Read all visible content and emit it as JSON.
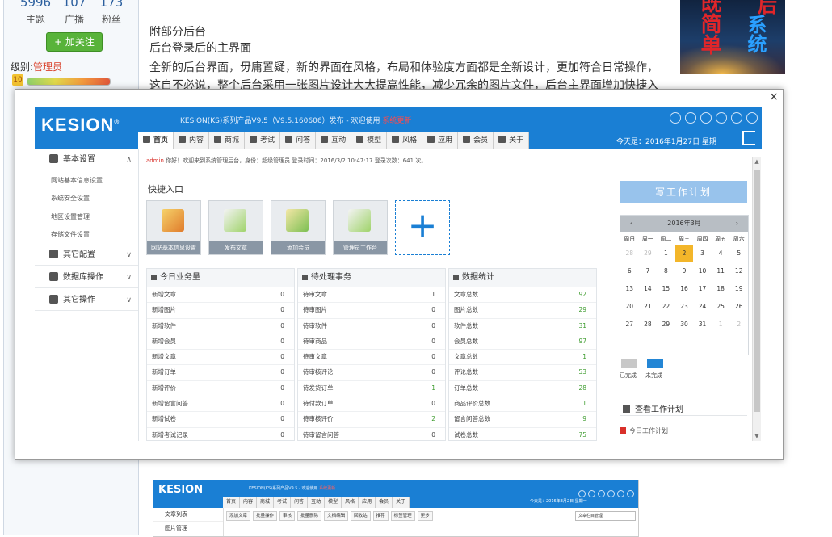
{
  "profile": {
    "stats": [
      {
        "num": "5996",
        "label": "主题"
      },
      {
        "num": "107",
        "label": "广播"
      },
      {
        "num": "173",
        "label": "粉丝"
      }
    ],
    "follow_label": "+ 加关注",
    "level_prefix": "级别:",
    "level_name": "管理员",
    "level_icon": "10"
  },
  "post": {
    "lines": [
      "附部分后台",
      "后台登录后的主界面",
      "全新的后台界面，毋庸置疑，新的界面在风格，布局和体验度方面都是全新设计，更加符合日常操作，",
      "这自不必说，整个后台采用一张图片设计大大提高性能，减少冗余的图片文件，后台主界面增加快捷入"
    ]
  },
  "banner": {
    "text_a": "既简单",
    "text_b": "系统",
    "text_c": "后"
  },
  "lightbox": {
    "close": "×"
  },
  "app": {
    "logo": "KESION",
    "logo_mark": "®",
    "sysinfo": "KESION(KS)系列产品V9.5（V9.5.160606）发布 - 欢迎使用",
    "sysinfo_red": "系统更新",
    "date": "今天是：2016年1月27日 星期一",
    "tabs": [
      "首页",
      "内容",
      "商城",
      "考试",
      "问答",
      "互动",
      "模型",
      "风格",
      "应用",
      "会员",
      "关于"
    ],
    "sidebar": {
      "groups": [
        {
          "label": "基本设置",
          "chev": "∧"
        },
        {
          "label": "其它配置",
          "chev": "∨"
        },
        {
          "label": "数据库操作",
          "chev": "∨"
        },
        {
          "label": "其它操作",
          "chev": "∨"
        }
      ],
      "subs": [
        "网站基本信息设置",
        "系统安全设置",
        "地区设置管理",
        "存储文件设置"
      ]
    },
    "breadcrumb_red": "admin",
    "breadcrumb": "你好！欢迎来到系统管理后台，身份：超级管理员 登录时间：2016/3/2 10:47:17 登录次数：641 次。",
    "quick_title": "快捷入口",
    "quick": [
      "网站基本信息设置",
      "发布文章",
      "添加会员",
      "管理员工作台"
    ],
    "panels": [
      {
        "title": "今日业务量",
        "rows": [
          {
            "k": "新增文章",
            "v": "0"
          },
          {
            "k": "新增图片",
            "v": "0"
          },
          {
            "k": "新增软件",
            "v": "0"
          },
          {
            "k": "新增会员",
            "v": "0"
          },
          {
            "k": "新增文章",
            "v": "0"
          },
          {
            "k": "新增订单",
            "v": "0"
          },
          {
            "k": "新增评价",
            "v": "0"
          },
          {
            "k": "新增留言问答",
            "v": "0"
          },
          {
            "k": "新增试卷",
            "v": "0"
          },
          {
            "k": "新增考试记录",
            "v": "0"
          }
        ]
      },
      {
        "title": "待处理事务",
        "rows": [
          {
            "k": "待审文章",
            "v": "1"
          },
          {
            "k": "待审图片",
            "v": "0"
          },
          {
            "k": "待审软件",
            "v": "0"
          },
          {
            "k": "待审商品",
            "v": "0"
          },
          {
            "k": "待审文章",
            "v": "0"
          },
          {
            "k": "待审核评论",
            "v": "0"
          },
          {
            "k": "待发货订单",
            "v": "1"
          },
          {
            "k": "待付款订单",
            "v": "0"
          },
          {
            "k": "待审核评价",
            "v": "2"
          },
          {
            "k": "待审留言问答",
            "v": "0"
          }
        ]
      },
      {
        "title": "数据统计",
        "rows": [
          {
            "k": "文章总数",
            "v": "92"
          },
          {
            "k": "图片总数",
            "v": "29"
          },
          {
            "k": "软件总数",
            "v": "31"
          },
          {
            "k": "会员总数",
            "v": "97"
          },
          {
            "k": "文章总数",
            "v": "1"
          },
          {
            "k": "评论总数",
            "v": "53"
          },
          {
            "k": "订单总数",
            "v": "28"
          },
          {
            "k": "商品评价总数",
            "v": "1"
          },
          {
            "k": "留言问答总数",
            "v": "9"
          },
          {
            "k": "试卷总数",
            "v": "75"
          }
        ]
      }
    ],
    "plan_button": "写工作计划",
    "calendar": {
      "title": "2016年3月",
      "prev": "‹",
      "next": "›",
      "week": [
        "周日",
        "周一",
        "周二",
        "周三",
        "周四",
        "周五",
        "周六"
      ],
      "days": [
        [
          "28",
          "o"
        ],
        [
          "29",
          "o"
        ],
        [
          "1",
          ""
        ],
        [
          "2",
          "sel"
        ],
        [
          "3",
          ""
        ],
        [
          "4",
          ""
        ],
        [
          "5",
          ""
        ],
        [
          "6",
          ""
        ],
        [
          "7",
          ""
        ],
        [
          "8",
          ""
        ],
        [
          "9",
          ""
        ],
        [
          "10",
          ""
        ],
        [
          "11",
          ""
        ],
        [
          "12",
          ""
        ],
        [
          "13",
          ""
        ],
        [
          "14",
          ""
        ],
        [
          "15",
          ""
        ],
        [
          "16",
          ""
        ],
        [
          "17",
          ""
        ],
        [
          "18",
          ""
        ],
        [
          "19",
          ""
        ],
        [
          "20",
          ""
        ],
        [
          "21",
          ""
        ],
        [
          "22",
          ""
        ],
        [
          "23",
          ""
        ],
        [
          "24",
          ""
        ],
        [
          "25",
          ""
        ],
        [
          "26",
          ""
        ],
        [
          "27",
          ""
        ],
        [
          "28",
          ""
        ],
        [
          "29",
          ""
        ],
        [
          "30",
          ""
        ],
        [
          "31",
          ""
        ],
        [
          "1",
          "o"
        ],
        [
          "2",
          "o"
        ]
      ]
    },
    "legend_a": "已完成",
    "legend_b": "未完成",
    "workplan_title": "查看工作计划",
    "workplan_item": "今日工作计划"
  },
  "app2": {
    "logo": "KESION",
    "sysinfo": "KESION(KS)系列产品V9.5 - 欢迎使用",
    "sysinfo_red": "系统更新",
    "date": "今天是：2016年3月2日 星期一",
    "tabs": [
      "首页",
      "内容",
      "商城",
      "考试",
      "问答",
      "互动",
      "模型",
      "风格",
      "应用",
      "会员",
      "关于"
    ],
    "sidebar": [
      "文章列表",
      "图片管理"
    ],
    "tools": [
      "添加文章",
      "批量操作",
      "审核",
      "批量删除",
      "文档编辑",
      "回收站",
      "推荐",
      "标签管理",
      "更多"
    ],
    "select": "文章栏目管理"
  }
}
